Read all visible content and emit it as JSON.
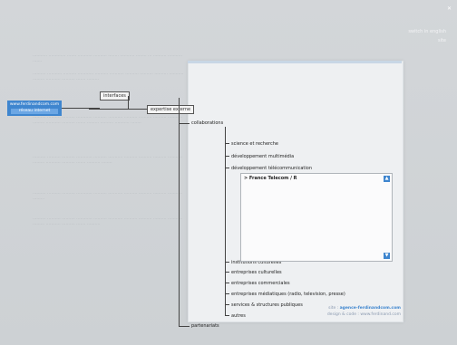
{
  "header": {
    "close": "✕",
    "line1": "switch in english",
    "line2": "site"
  },
  "badge": {
    "title": "www.ferdinandcom.com",
    "sub": "réseau internet"
  },
  "diagram": {
    "interfaces": "interfaces",
    "expertise": "expertise externe",
    "collaborations": "collaborations",
    "partenariats": "partenariats"
  },
  "tree": [
    "science et recherche",
    "développement multimédia",
    "développement télécommunication",
    "institutions culturelles",
    "entreprises culturelles",
    "entreprises commerciales",
    "entreprises médiatiques (radio, television, presse)",
    "services & structures publiques",
    "autres"
  ],
  "inner": {
    "title": "> France Telecom / R"
  },
  "footer": {
    "line1_prefix": "site",
    "line1_link": "agence-ferdinandcom.com",
    "line2": "design & code : www.ferdinand.com"
  }
}
